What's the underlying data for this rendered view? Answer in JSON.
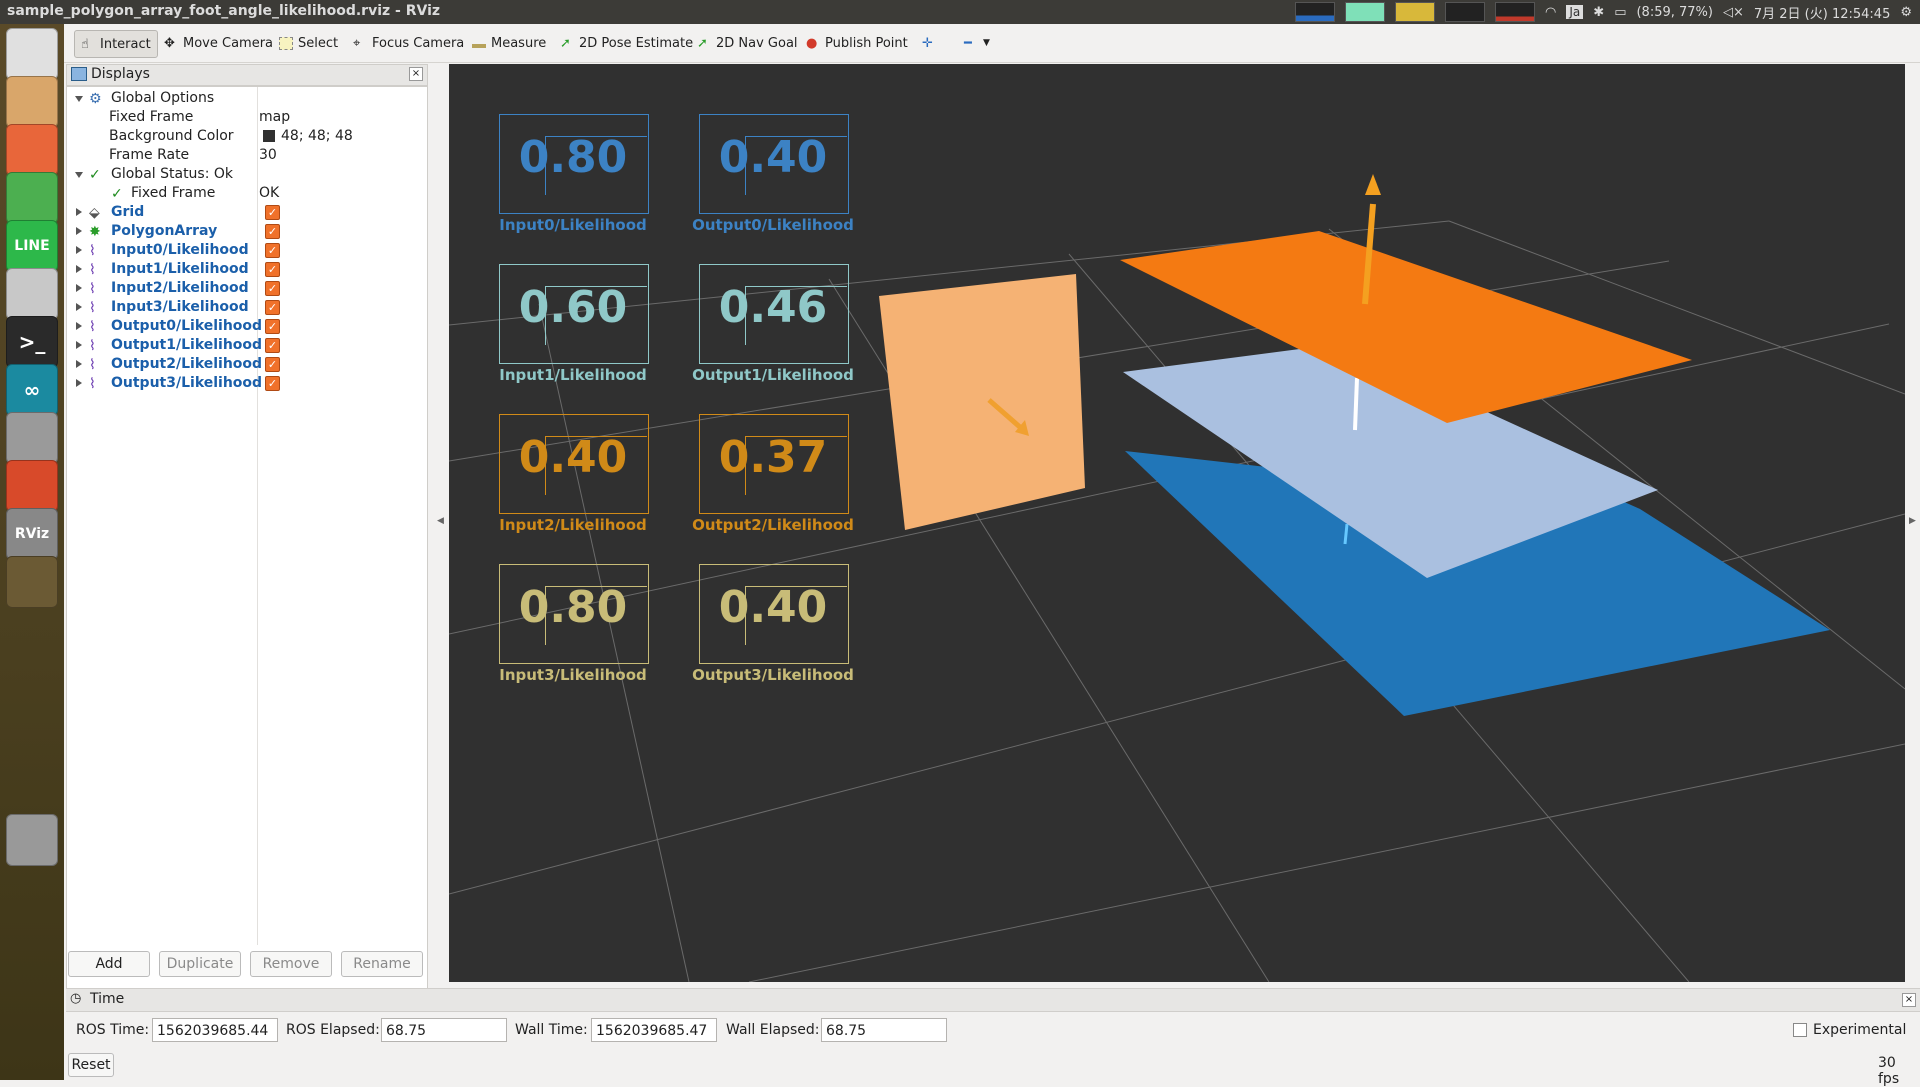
{
  "window": {
    "title": "sample_polygon_array_foot_angle_likelihood.rviz - RViz"
  },
  "tray": {
    "keyboard": "Ja",
    "battery": "(8:59, 77%)",
    "datetime": "7月 2日 (火) 12:54:45"
  },
  "launcher": {
    "items": [
      {
        "name": "ubuntu-dash-icon",
        "label": ""
      },
      {
        "name": "file-manager-icon",
        "label": ""
      },
      {
        "name": "firefox-icon",
        "label": ""
      },
      {
        "name": "chrome-icon",
        "label": ""
      },
      {
        "name": "line-app-icon",
        "label": "LINE"
      },
      {
        "name": "disk-icon",
        "label": ""
      },
      {
        "name": "terminal-icon",
        "label": ">_"
      },
      {
        "name": "arduino-icon",
        "label": "∞"
      },
      {
        "name": "camera-icon",
        "label": ""
      },
      {
        "name": "settings-icon",
        "label": ""
      },
      {
        "name": "rviz-icon",
        "label": "RViz"
      },
      {
        "name": "workspace-switcher-icon",
        "label": ""
      },
      {
        "name": "trash-icon",
        "label": ""
      }
    ]
  },
  "toolbar": {
    "interact": "Interact",
    "move_camera": "Move Camera",
    "select": "Select",
    "focus_camera": "Focus Camera",
    "measure": "Measure",
    "pose_estimate": "2D Pose Estimate",
    "nav_goal": "2D Nav Goal",
    "publish_point": "Publish Point"
  },
  "displays": {
    "title": "Displays",
    "global_options": "Global Options",
    "fixed_frame_label": "Fixed Frame",
    "fixed_frame_value": "map",
    "bg_color_label": "Background Color",
    "bg_color_value": "48; 48; 48",
    "frame_rate_label": "Frame Rate",
    "frame_rate_value": "30",
    "global_status": "Global Status: Ok",
    "status_fixed_frame": "Fixed Frame",
    "status_fixed_frame_value": "OK",
    "items": [
      "Grid",
      "PolygonArray",
      "Input0/Likelihood",
      "Input1/Likelihood",
      "Input2/Likelihood",
      "Input3/Likelihood",
      "Output0/Likelihood",
      "Output1/Likelihood",
      "Output2/Likelihood",
      "Output3/Likelihood"
    ],
    "buttons": {
      "add": "Add",
      "duplicate": "Duplicate",
      "remove": "Remove",
      "rename": "Rename"
    }
  },
  "overlays": [
    {
      "value": "0.80",
      "label": "Input0/Likelihood",
      "color": "#3c82c4"
    },
    {
      "value": "0.40",
      "label": "Output0/Likelihood",
      "color": "#3c82c4"
    },
    {
      "value": "0.60",
      "label": "Input1/Likelihood",
      "color": "#8fc8c8"
    },
    {
      "value": "0.46",
      "label": "Output1/Likelihood",
      "color": "#8fc8c8"
    },
    {
      "value": "0.40",
      "label": "Input2/Likelihood",
      "color": "#d08a18"
    },
    {
      "value": "0.37",
      "label": "Output2/Likelihood",
      "color": "#d08a18"
    },
    {
      "value": "0.80",
      "label": "Input3/Likelihood",
      "color": "#c8bc78"
    },
    {
      "value": "0.40",
      "label": "Output3/Likelihood",
      "color": "#c8bc78"
    }
  ],
  "time": {
    "title": "Time",
    "ros_time_label": "ROS Time:",
    "ros_time_value": "1562039685.44",
    "ros_elapsed_label": "ROS Elapsed:",
    "ros_elapsed_value": "68.75",
    "wall_time_label": "Wall Time:",
    "wall_time_value": "1562039685.47",
    "wall_elapsed_label": "Wall Elapsed:",
    "wall_elapsed_value": "68.75",
    "experimental": "Experimental",
    "reset": "Reset",
    "fps": "30 fps"
  },
  "colors": {
    "view_bg": "#303030",
    "orange": "#f47a12",
    "light_orange": "#f5b274",
    "light_blue": "#aac0e0",
    "blue": "#2176b8"
  }
}
